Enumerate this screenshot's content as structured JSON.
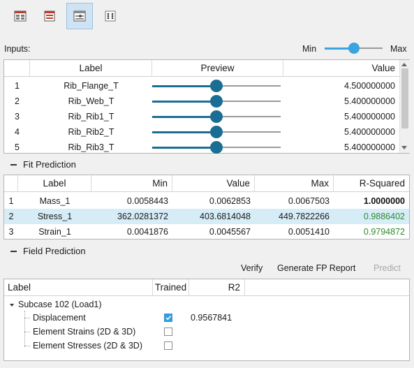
{
  "toolbar": {
    "buttons": [
      {
        "name": "table-view-icon",
        "active": false
      },
      {
        "name": "list-view-icon",
        "active": false
      },
      {
        "name": "chart-view-icon",
        "active": true
      },
      {
        "name": "dice-view-icon",
        "active": false
      }
    ]
  },
  "inputs": {
    "label": "Inputs:",
    "min_label": "Min",
    "max_label": "Max",
    "slider_level": 0.5,
    "columns": [
      "Label",
      "Preview",
      "Value"
    ],
    "rows": [
      {
        "index": "1",
        "label": "Rib_Flange_T",
        "preview": 0.5,
        "value": "4.500000000"
      },
      {
        "index": "2",
        "label": "Rib_Web_T",
        "preview": 0.5,
        "value": "5.400000000"
      },
      {
        "index": "3",
        "label": "Rib_Rib1_T",
        "preview": 0.5,
        "value": "5.400000000"
      },
      {
        "index": "4",
        "label": "Rib_Rib2_T",
        "preview": 0.5,
        "value": "5.400000000"
      },
      {
        "index": "5",
        "label": "Rib_Rib3_T",
        "preview": 0.5,
        "value": "5.400000000"
      }
    ]
  },
  "fit": {
    "title": "Fit Prediction",
    "columns": [
      "Label",
      "Min",
      "Value",
      "Max",
      "R-Squared"
    ],
    "rows": [
      {
        "index": "1",
        "label": "Mass_1",
        "min": "0.0058443",
        "value": "0.0062853",
        "max": "0.0067503",
        "r2": "1.0000000"
      },
      {
        "index": "2",
        "label": "Stress_1",
        "min": "362.0281372",
        "value": "403.6814048",
        "max": "449.7822266",
        "r2": "0.9886402"
      },
      {
        "index": "3",
        "label": "Strain_1",
        "min": "0.0041876",
        "value": "0.0045567",
        "max": "0.0051410",
        "r2": "0.9794872"
      }
    ],
    "colors": {
      "r2_green": "#2e8b2e",
      "selected_row": "#d6ecf7"
    }
  },
  "field": {
    "title": "Field Prediction",
    "actions": {
      "verify": "Verify",
      "report": "Generate FP Report",
      "predict": "Predict"
    },
    "columns": [
      "Label",
      "Trained",
      "R2"
    ],
    "subcase": "Subcase 102 (Load1)",
    "items": [
      {
        "label": "Displacement",
        "trained": true,
        "r2": "0.9567841"
      },
      {
        "label": "Element Strains (2D & 3D)",
        "trained": false,
        "r2": ""
      },
      {
        "label": "Element Stresses (2D & 3D)",
        "trained": false,
        "r2": ""
      }
    ]
  }
}
